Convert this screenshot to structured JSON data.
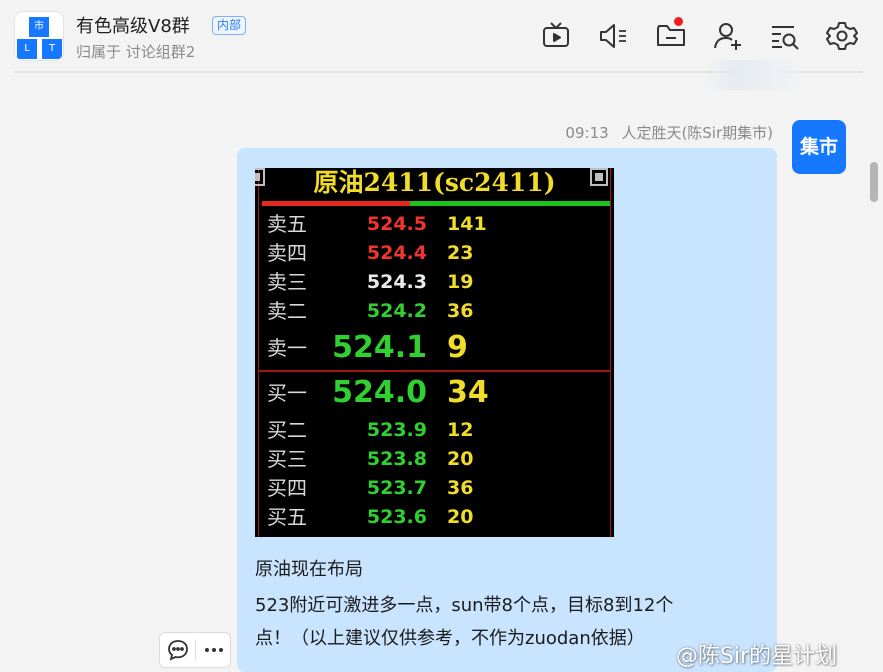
{
  "header": {
    "avatar_chars": [
      "市",
      "L",
      "T"
    ],
    "title": "有色高级V8群",
    "badge": "内部",
    "subtitle": "归属于 讨论组群2",
    "toolbar_icons": [
      "tv-icon",
      "speaker-mute-icon",
      "folder-icon",
      "add-user-icon",
      "search-list-icon",
      "gear-icon"
    ],
    "folder_has_notification": true
  },
  "message": {
    "time": "09:13",
    "sender": "人定胜天(陈Sir期集市)",
    "sender_avatar_text": "集市",
    "quote_image": {
      "title": "原油2411(sc2411)",
      "asks": [
        {
          "label": "卖五",
          "price": "524.5",
          "volume": "141",
          "color": "#f0352e"
        },
        {
          "label": "卖四",
          "price": "524.4",
          "volume": "23",
          "color": "#f0352e"
        },
        {
          "label": "卖三",
          "price": "524.3",
          "volume": "19",
          "color": "#eaeaea"
        },
        {
          "label": "卖二",
          "price": "524.2",
          "volume": "36",
          "color": "#2fd02f"
        },
        {
          "label": "卖一",
          "price": "524.1",
          "volume": "9",
          "color": "#2fd02f"
        }
      ],
      "bids": [
        {
          "label": "买一",
          "price": "524.0",
          "volume": "34",
          "color": "#2fd02f"
        },
        {
          "label": "买二",
          "price": "523.9",
          "volume": "12",
          "color": "#2fd02f"
        },
        {
          "label": "买三",
          "price": "523.8",
          "volume": "20",
          "color": "#2fd02f"
        },
        {
          "label": "买四",
          "price": "523.7",
          "volume": "36",
          "color": "#2fd02f"
        },
        {
          "label": "买五",
          "price": "523.6",
          "volume": "20",
          "color": "#2fd02f"
        }
      ]
    },
    "text_lines": [
      "原油现在布局",
      "523附近可激进多一点，sun带8个点，目标8到12个",
      "点！（以上建议仅供参考，不作为zuodan依据）"
    ]
  },
  "actions": {
    "icons": [
      "comment-icon",
      "more-icon"
    ]
  },
  "watermark": "@陈Sir的星计划"
}
